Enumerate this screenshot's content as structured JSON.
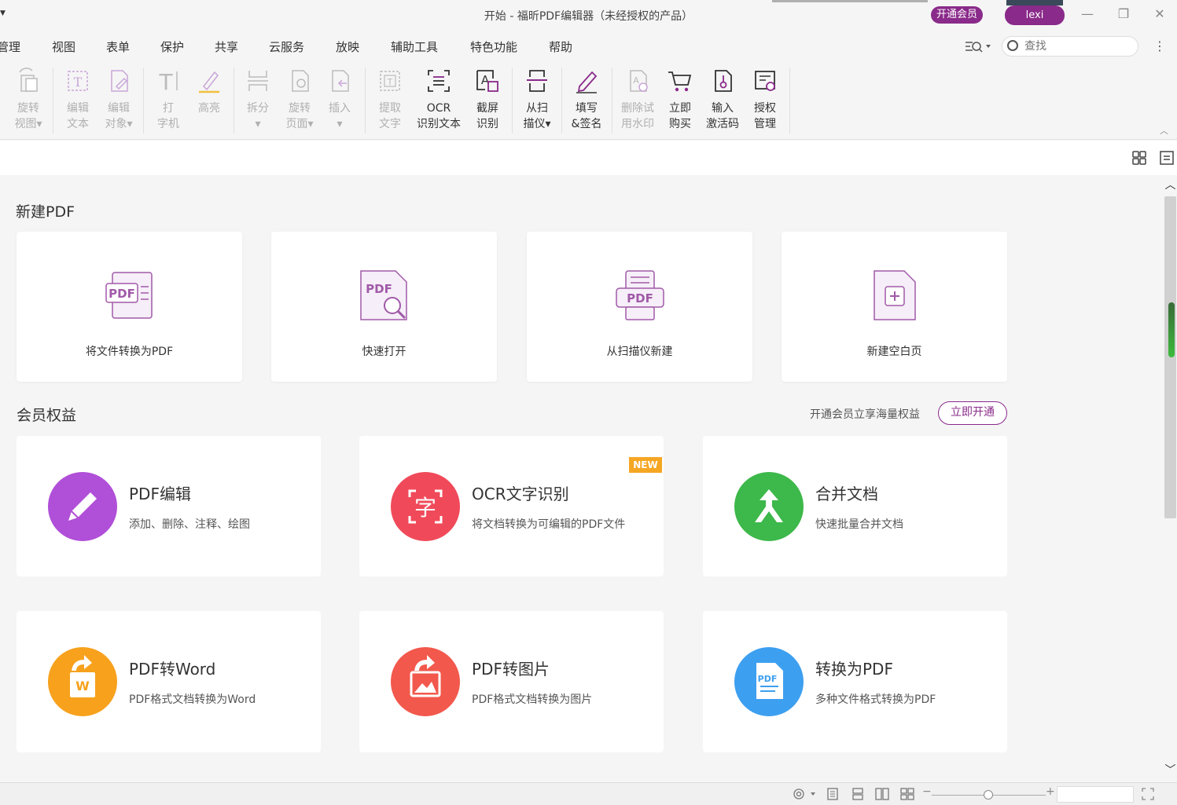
{
  "window": {
    "title": "开始 - 福昕PDF编辑器（未经授权的产品）",
    "vip_label": "开通会员",
    "user_name": "lexi",
    "minimize": "—",
    "restore": "❐",
    "close": "✕"
  },
  "menu": {
    "items": [
      "管理",
      "视图",
      "表单",
      "保护",
      "共享",
      "云服务",
      "放映",
      "辅助工具",
      "特色功能",
      "帮助"
    ],
    "search_placeholder": "查找"
  },
  "ribbon": {
    "tools": [
      {
        "label": "旋转\n视图▾",
        "icon": "rotate-view-icon",
        "enabled": false
      },
      {
        "label": "编辑\n文本",
        "icon": "edit-text-icon",
        "enabled": false
      },
      {
        "label": "编辑\n对象▾",
        "icon": "edit-object-icon",
        "enabled": false
      },
      {
        "label": "打\n字机",
        "icon": "typewriter-icon",
        "enabled": false
      },
      {
        "label": "高亮",
        "icon": "highlight-icon",
        "enabled": false
      },
      {
        "label": "拆分\n▾",
        "icon": "split-icon",
        "enabled": false
      },
      {
        "label": "旋转\n页面▾",
        "icon": "rotate-page-icon",
        "enabled": false
      },
      {
        "label": "插入\n▾",
        "icon": "insert-icon",
        "enabled": false
      },
      {
        "label": "提取\n文字",
        "icon": "extract-text-icon",
        "enabled": false
      },
      {
        "label": "OCR\n识别文本",
        "icon": "ocr-icon",
        "enabled": true
      },
      {
        "label": "截屏\n识别",
        "icon": "screenshot-ocr-icon",
        "enabled": true
      },
      {
        "label": "从扫\n描仪▾",
        "icon": "scanner-icon",
        "enabled": true
      },
      {
        "label": "填写\n&签名",
        "icon": "fill-sign-icon",
        "enabled": true
      },
      {
        "label": "删除试\n用水印",
        "icon": "remove-watermark-icon",
        "enabled": false
      },
      {
        "label": "立即\n购买",
        "icon": "cart-icon",
        "enabled": true
      },
      {
        "label": "输入\n激活码",
        "icon": "activation-code-icon",
        "enabled": true
      },
      {
        "label": "授权\n管理",
        "icon": "license-manage-icon",
        "enabled": true
      }
    ]
  },
  "new_pdf": {
    "title": "新建PDF",
    "cards": [
      {
        "label": "将文件转换为PDF",
        "icon": "convert-to-pdf-icon"
      },
      {
        "label": "快速打开",
        "icon": "quick-open-icon"
      },
      {
        "label": "从扫描仪新建",
        "icon": "scan-new-icon"
      },
      {
        "label": "新建空白页",
        "icon": "blank-page-icon"
      }
    ]
  },
  "member": {
    "title": "会员权益",
    "promo_text": "开通会员立享海量权益",
    "open_button": "立即开通",
    "features": [
      {
        "title": "PDF编辑",
        "desc": "添加、删除、注释、绘图",
        "icon": "pencil-icon",
        "color": "#b04fd8"
      },
      {
        "title": "OCR文字识别",
        "desc": "将文档转换为可编辑的PDF文件",
        "icon": "ocr-char-icon",
        "color": "#f04a5a",
        "badge": "NEW"
      },
      {
        "title": "合并文档",
        "desc": "快速批量合并文档",
        "icon": "merge-icon",
        "color": "#3db84a"
      },
      {
        "title": "PDF转Word",
        "desc": "PDF格式文档转换为Word",
        "icon": "word-icon",
        "color": "#f7a11d"
      },
      {
        "title": "PDF转图片",
        "desc": "PDF格式文档转换为图片",
        "icon": "image-icon",
        "color": "#f2584c"
      },
      {
        "title": "转换为PDF",
        "desc": "多种文件格式转换为PDF",
        "icon": "pdf-file-icon",
        "color": "#3d9ff0"
      }
    ]
  }
}
